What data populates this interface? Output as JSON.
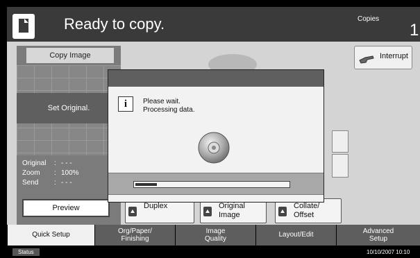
{
  "header": {
    "title": "Ready to copy.",
    "copies_label": "Copies",
    "copies_value": "1"
  },
  "left_panel": {
    "copy_image_label": "Copy Image",
    "set_original_label": "Set Original.",
    "info": [
      {
        "key": "Original",
        "value": "- - -"
      },
      {
        "key": "Zoom",
        "value": "100%"
      },
      {
        "key": "Send",
        "value": "- - -"
      }
    ],
    "preview_label": "Preview"
  },
  "interrupt": {
    "label": "Interrupt"
  },
  "dialog": {
    "message_line1": "Please wait.",
    "message_line2": "Processing data.",
    "progress": 0.14
  },
  "function_buttons": [
    {
      "line1": "Duplex",
      "line2": ""
    },
    {
      "line1": "Original",
      "line2": "Image"
    },
    {
      "line1": "Collate/",
      "line2": "Offset"
    }
  ],
  "tabs": [
    {
      "line1": "Quick Setup",
      "line2": "",
      "active": true
    },
    {
      "line1": "Org/Paper/",
      "line2": "Finishing",
      "active": false
    },
    {
      "line1": "Image",
      "line2": "Quality",
      "active": false
    },
    {
      "line1": "Layout/Edit",
      "line2": "",
      "active": false
    },
    {
      "line1": "Advanced",
      "line2": "Setup",
      "active": false
    }
  ],
  "status": {
    "label": "Status",
    "datetime": "10/10/2007    10:10"
  },
  "icons": {
    "document": "document-icon",
    "interrupt": "interrupt-hand-icon",
    "info": "info-icon",
    "disc": "disc-icon",
    "arrow": "up-arrow-icon"
  }
}
